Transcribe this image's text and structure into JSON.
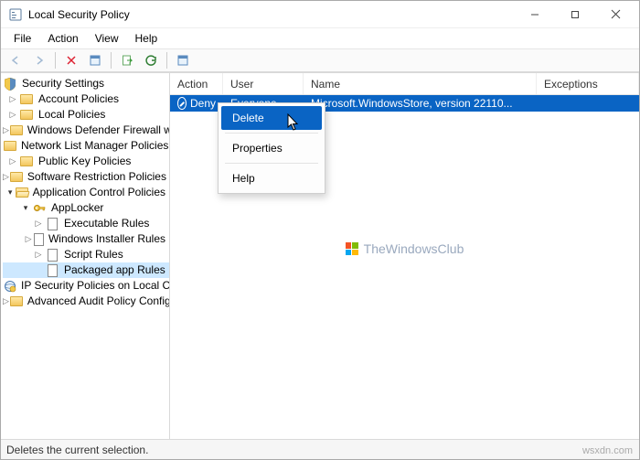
{
  "window": {
    "title": "Local Security Policy"
  },
  "menubar": {
    "file": "File",
    "action": "Action",
    "view": "View",
    "help": "Help"
  },
  "tree": {
    "root": "Security Settings",
    "account": "Account Policies",
    "local": "Local Policies",
    "wdf": "Windows Defender Firewall wit",
    "nlmp": "Network List Manager Policies",
    "pkp": "Public Key Policies",
    "srp": "Software Restriction Policies",
    "acp": "Application Control Policies",
    "applocker": "AppLocker",
    "exec": "Executable Rules",
    "wi": "Windows Installer Rules",
    "script": "Script Rules",
    "packaged": "Packaged app Rules",
    "ipsec": "IP Security Policies on Local Co",
    "aapc": "Advanced Audit Policy Config"
  },
  "columns": {
    "action": "Action",
    "user": "User",
    "name": "Name",
    "exceptions": "Exceptions"
  },
  "row": {
    "action": "Deny",
    "user": "Everyone",
    "name": "Microsoft.WindowsStore, version 22110..."
  },
  "context": {
    "delete": "Delete",
    "properties": "Properties",
    "help": "Help"
  },
  "statusbar": "Deletes the current selection.",
  "brand": "TheWindowsClub",
  "watermark": "wsxdn.com"
}
